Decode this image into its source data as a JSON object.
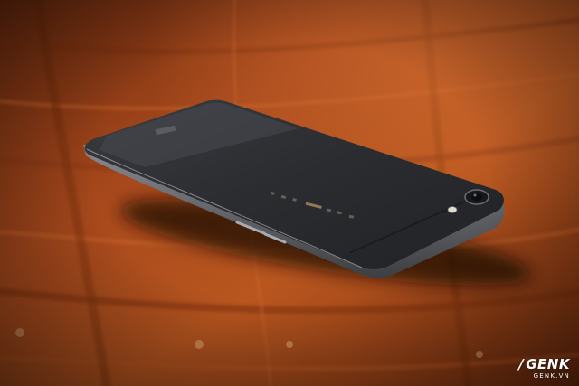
{
  "scene": {
    "subject": "smartphone",
    "phone_color": "#2d2f33",
    "frame_color": "#5b5e63",
    "table_color": "#a8491c"
  },
  "watermark": {
    "mark": "/",
    "brand": "GENK",
    "site": "GENK.VN"
  }
}
